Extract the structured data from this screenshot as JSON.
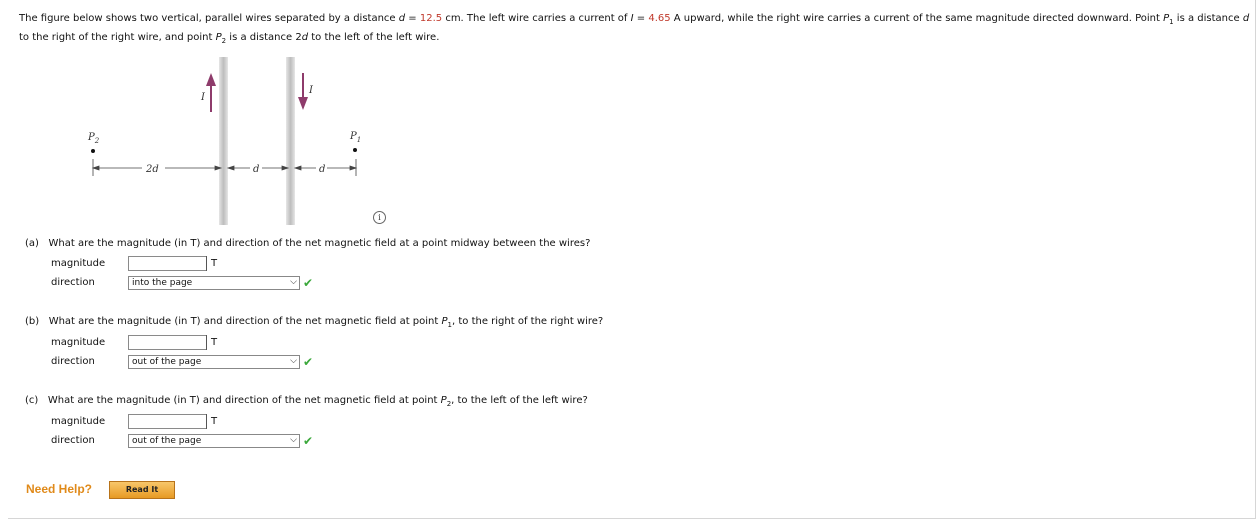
{
  "intro": {
    "t1": "The figure below shows two vertical, parallel wires separated by a distance ",
    "d_sym": "d",
    "t2": " = ",
    "d_val": "12.5",
    "t3": " cm. The left wire carries a current of ",
    "i_sym": "I",
    "t4": " = ",
    "i_val": "4.65",
    "t5": " A upward, while the right wire carries a current of the same magnitude directed downward. Point ",
    "p1": "P",
    "p1_sub": "1",
    "t6": " is a distance ",
    "d_sym2": "d",
    "t7": " to the right of the right wire, and point ",
    "p2": "P",
    "p2_sub": "2",
    "t8": " is a distance 2",
    "d_sym3": "d",
    "t9": " to the left of the left wire."
  },
  "figure": {
    "p2_label": "P",
    "p2_sub": "2",
    "p1_label": "P",
    "p1_sub": "1",
    "left_current": "I",
    "right_current": "I",
    "dist_2d": "2d",
    "dist_d_mid": "d",
    "dist_d_right": "d"
  },
  "parts": [
    {
      "prefix": "(a)",
      "question": "What are the magnitude (in T) and direction of the net magnetic field at a point midway between the wires?",
      "magnitude_label": "magnitude",
      "unit": "T",
      "direction_label": "direction",
      "direction_value": "into the page"
    },
    {
      "prefix": "(b)",
      "question_pre": "What are the magnitude (in T) and direction of the net magnetic field at point ",
      "point": "P",
      "point_sub": "1",
      "question_post": ", to the right of the right wire?",
      "magnitude_label": "magnitude",
      "unit": "T",
      "direction_label": "direction",
      "direction_value": "out of the page"
    },
    {
      "prefix": "(c)",
      "question_pre": "What are the magnitude (in T) and direction of the net magnetic field at point ",
      "point": "P",
      "point_sub": "2",
      "question_post": ", to the left of the left wire?",
      "magnitude_label": "magnitude",
      "unit": "T",
      "direction_label": "direction",
      "direction_value": "out of the page"
    }
  ],
  "help": {
    "label": "Need Help?",
    "read_it": "Read It"
  },
  "colors": {
    "accent_red": "#c0392b",
    "arrow": "#8e3b6b",
    "check": "#3aa83a",
    "help": "#e08a1a"
  }
}
